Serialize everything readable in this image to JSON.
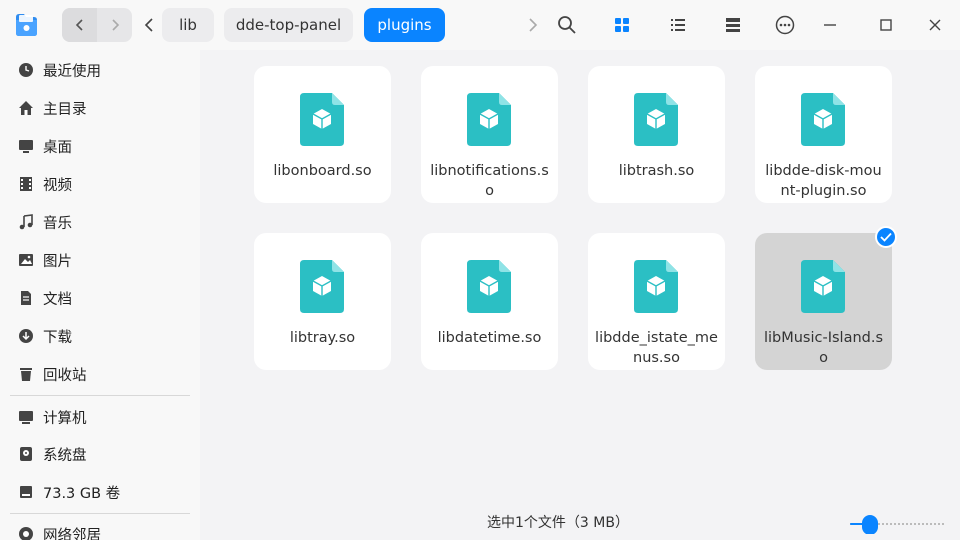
{
  "toolbar": {
    "breadcrumbs": [
      "lib",
      "dde-top-panel",
      "plugins"
    ],
    "icons": [
      "back-arrow-icon",
      "forward-arrow-icon",
      "search-icon",
      "icon-view-icon",
      "list-view-icon",
      "tree-view-icon",
      "more-options-icon",
      "minimize-icon",
      "maximize-icon",
      "close-icon"
    ]
  },
  "sidebar": {
    "items": [
      {
        "label": "最近使用",
        "icon": "clock-icon"
      },
      {
        "label": "主目录",
        "icon": "home-icon"
      },
      {
        "label": "桌面",
        "icon": "desktop-icon"
      },
      {
        "label": "视频",
        "icon": "video-icon"
      },
      {
        "label": "音乐",
        "icon": "music-icon"
      },
      {
        "label": "图片",
        "icon": "picture-icon"
      },
      {
        "label": "文档",
        "icon": "document-icon"
      },
      {
        "label": "下载",
        "icon": "download-icon"
      },
      {
        "label": "回收站",
        "icon": "trash-icon"
      }
    ],
    "devices": [
      {
        "label": "计算机",
        "icon": "computer-icon"
      },
      {
        "label": "系统盘",
        "icon": "disk-icon"
      },
      {
        "label": "73.3 GB 卷",
        "icon": "drive-icon"
      }
    ],
    "network": {
      "label": "网络邻居",
      "icon": "network-icon"
    }
  },
  "files": [
    {
      "name": "libonboard.so",
      "selected": false
    },
    {
      "name": "libnotifications.so",
      "selected": false
    },
    {
      "name": "libtrash.so",
      "selected": false
    },
    {
      "name": "libdde-disk-mount-plugin.so",
      "selected": false
    },
    {
      "name": "libtray.so",
      "selected": false
    },
    {
      "name": "libdatetime.so",
      "selected": false
    },
    {
      "name": "libdde_istate_menus.so",
      "selected": false
    },
    {
      "name": "libMusic-Island.so",
      "selected": true
    }
  ],
  "status": {
    "text": "选中1个文件（3 MB）"
  },
  "zoom": {
    "level": 0.2
  },
  "colors": {
    "accent": "#0a84ff",
    "file_icon": "#2bbfc4"
  }
}
